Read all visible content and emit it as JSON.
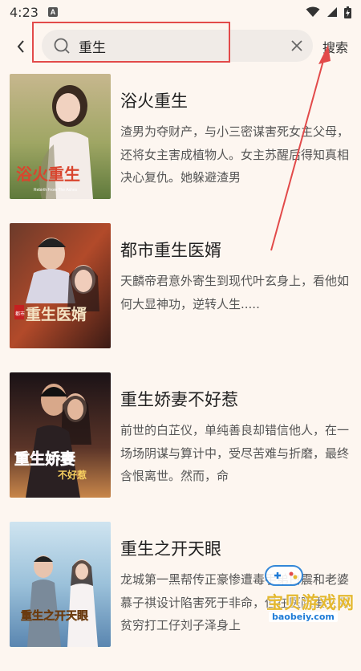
{
  "status": {
    "time": "4:23",
    "notification_icon": "A"
  },
  "search": {
    "query": "重生",
    "button_label": "搜索"
  },
  "results": [
    {
      "title": "浴火重生",
      "description": "渣男为夺财产，与小三密谋害死女主父母，还将女主害成植物人。女主苏醒后得知真相决心复仇。她躲避渣男",
      "cover_text": "浴火重生",
      "cover_subtext": "Rebirth From The Ashes"
    },
    {
      "title": "都市重生医婿",
      "description": "天麟帝君意外寄生到现代叶玄身上，看他如何大显神功，逆转人生.....",
      "cover_text": "重生医婿",
      "cover_subtext": "都市"
    },
    {
      "title": "重生娇妻不好惹",
      "description": "前世的白芷仪，单纯善良却错信他人，在一场场阴谋与算计中，受尽苦难与折磨，最终含恨离世。然而，命",
      "cover_text": "重生娇妻",
      "cover_subtext": "不好惹"
    },
    {
      "title": "重生之开天眼",
      "description": "龙城第一黑帮传正豪惨遭毒手弟白震和老婆慕子祺设计陷害死于非命，但在医院重生到贫穷打工仔刘子泽身上",
      "cover_text": "重生之开天眼",
      "cover_subtext": ""
    }
  ],
  "watermark": {
    "text": "宝贝游戏网",
    "url": "baobeiy.com"
  },
  "colors": {
    "background": "#fdf6f0",
    "annotation": "#e24a4a"
  }
}
